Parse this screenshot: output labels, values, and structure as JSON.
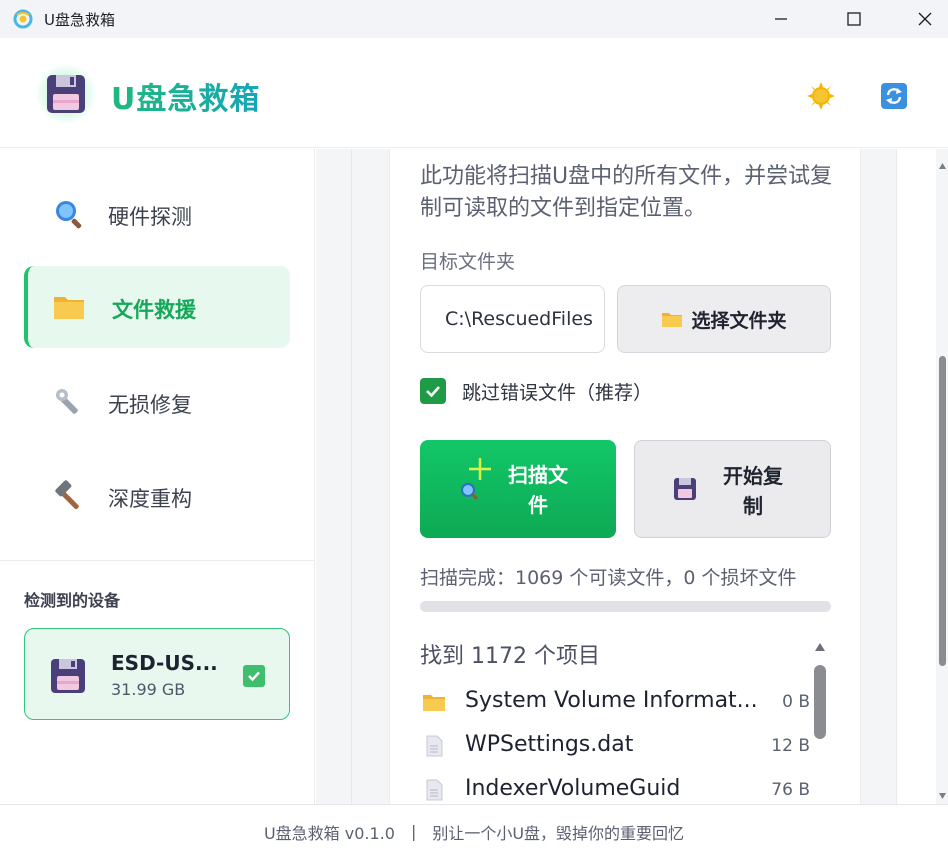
{
  "window": {
    "title": "U盘急救箱"
  },
  "header": {
    "app_name": "U盘急救箱"
  },
  "sidebar": {
    "items": [
      {
        "label": "硬件探测",
        "icon": "magnifier-icon",
        "active": false
      },
      {
        "label": "文件救援",
        "icon": "folder-icon",
        "active": true
      },
      {
        "label": "无损修复",
        "icon": "wrench-icon",
        "active": false
      },
      {
        "label": "深度重构",
        "icon": "hammer-icon",
        "active": false
      }
    ],
    "devices_title": "检测到的设备",
    "device": {
      "name": "ESD-US...",
      "size": "31.99 GB",
      "selected": true
    }
  },
  "rescue": {
    "description": "此功能将扫描U盘中的所有文件，并尝试复制可读取的文件到指定位置。",
    "target_label": "目标文件夹",
    "target_value": "C:\\RescuedFiles",
    "choose_button": "选择文件夹",
    "skip_errors_label": "跳过错误文件（推荐）",
    "skip_errors_checked": true,
    "scan_button": "扫描文件",
    "copy_button": "开始复制",
    "status": "扫描完成：1069 个可读文件，0 个损坏文件",
    "progress_fraction": 0,
    "found_title": "找到 1172 个项目",
    "files": [
      {
        "name": "System Volume Informat...",
        "size": "0 B",
        "type": "folder"
      },
      {
        "name": "WPSettings.dat",
        "size": "12 B",
        "type": "file"
      },
      {
        "name": "IndexerVolumeGuid",
        "size": "76 B",
        "type": "file"
      }
    ]
  },
  "footer": {
    "version": "U盘急救箱 v0.1.0",
    "separator": "|",
    "slogan": "别让一个小U盘，毁掉你的重要回忆"
  },
  "colors": {
    "accent": "#21c26d",
    "brand_start": "#1fb97c",
    "brand_end": "#16a6b8",
    "active_bg": "#e7f8ee"
  }
}
